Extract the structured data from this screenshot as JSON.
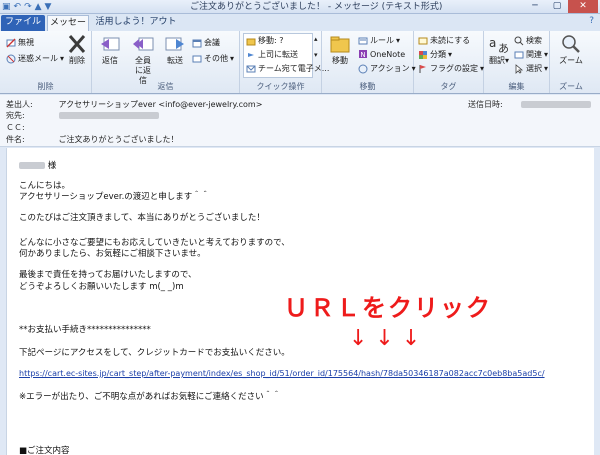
{
  "window": {
    "title": "ご注文ありがとうございました！ - メッセージ (テキスト形式)",
    "qat_icons": [
      "save-icon",
      "undo-icon",
      "redo-icon",
      "up-arrow-icon",
      "down-arrow-icon"
    ]
  },
  "tabs": [
    "ファイル",
    "メッセージ",
    "活用しよう！アウトルック"
  ],
  "ribbon": {
    "delete_group": {
      "label": "削除",
      "ignore": "無視",
      "junk": "迷惑メール",
      "delete": "削除"
    },
    "respond_group": {
      "label": "返信",
      "reply": "返信",
      "reply_all": "全員に返信",
      "forward": "転送",
      "meeting": "会議",
      "more": "その他"
    },
    "quick_group": {
      "label": "クイック操作",
      "items": [
        "移動: ?",
        "上司に転送",
        "チーム宛て電子メ..."
      ]
    },
    "move_group": {
      "label": "移動",
      "move": "移動",
      "rules": "ルール",
      "onenote": "OneNote",
      "actions": "アクション"
    },
    "tags_group": {
      "label": "タグ",
      "unread": "未読にする",
      "categorize": "分類",
      "followup": "フラグの設定"
    },
    "edit_group": {
      "label": "編集",
      "translate": "翻訳",
      "find": "検索",
      "related": "関連",
      "select": "選択"
    },
    "zoom_group": {
      "label": "ズーム",
      "zoom": "ズーム"
    }
  },
  "header": {
    "from_label": "差出人:",
    "from_value": "アクセサリーショップever <info@ever-jewelry.com>",
    "sent_label": "送信日時:",
    "to_label": "宛先:",
    "cc_label": "ＣＣ:",
    "subject_label": "件名:",
    "subject_value": "ご注文ありがとうございました！"
  },
  "body": {
    "salutation_suffix": "様",
    "lines": [
      "こんにちは。",
      "アクセサリーショップever.の渡辺と申します＾＾",
      "このたびはご注文頂きまして、本当にありがとうございました！",
      "どんなに小さなご要望にもお応えしていきたいと考えておりますので、",
      "何かありましたら、お気軽にご相談下さいませ。",
      "最後まで責任を持ってお届けいたしますので、",
      "どうぞよろしくお願いいたします m(_ _)m",
      "**お支払い手続き***************",
      "下記ページにアクセスをして、クレジットカードでお支払いください。",
      "※エラーが出たり、ご不明な点があればお気軽にご連絡ください＾＾",
      "■ご注文内容"
    ],
    "url": "https://cart.ec-sites.jp/cart_step/after-payment/index/es_shop_id/51/order_id/175564/hash/78da50346187a082acc7c0eb8ba5ad5c/",
    "annotation": "ＵＲＬをクリック",
    "arrows": "↓↓↓"
  },
  "colors": {
    "accent": "#2f63b7",
    "annotation": "#ee1b1b",
    "link": "#1b3fa8"
  }
}
